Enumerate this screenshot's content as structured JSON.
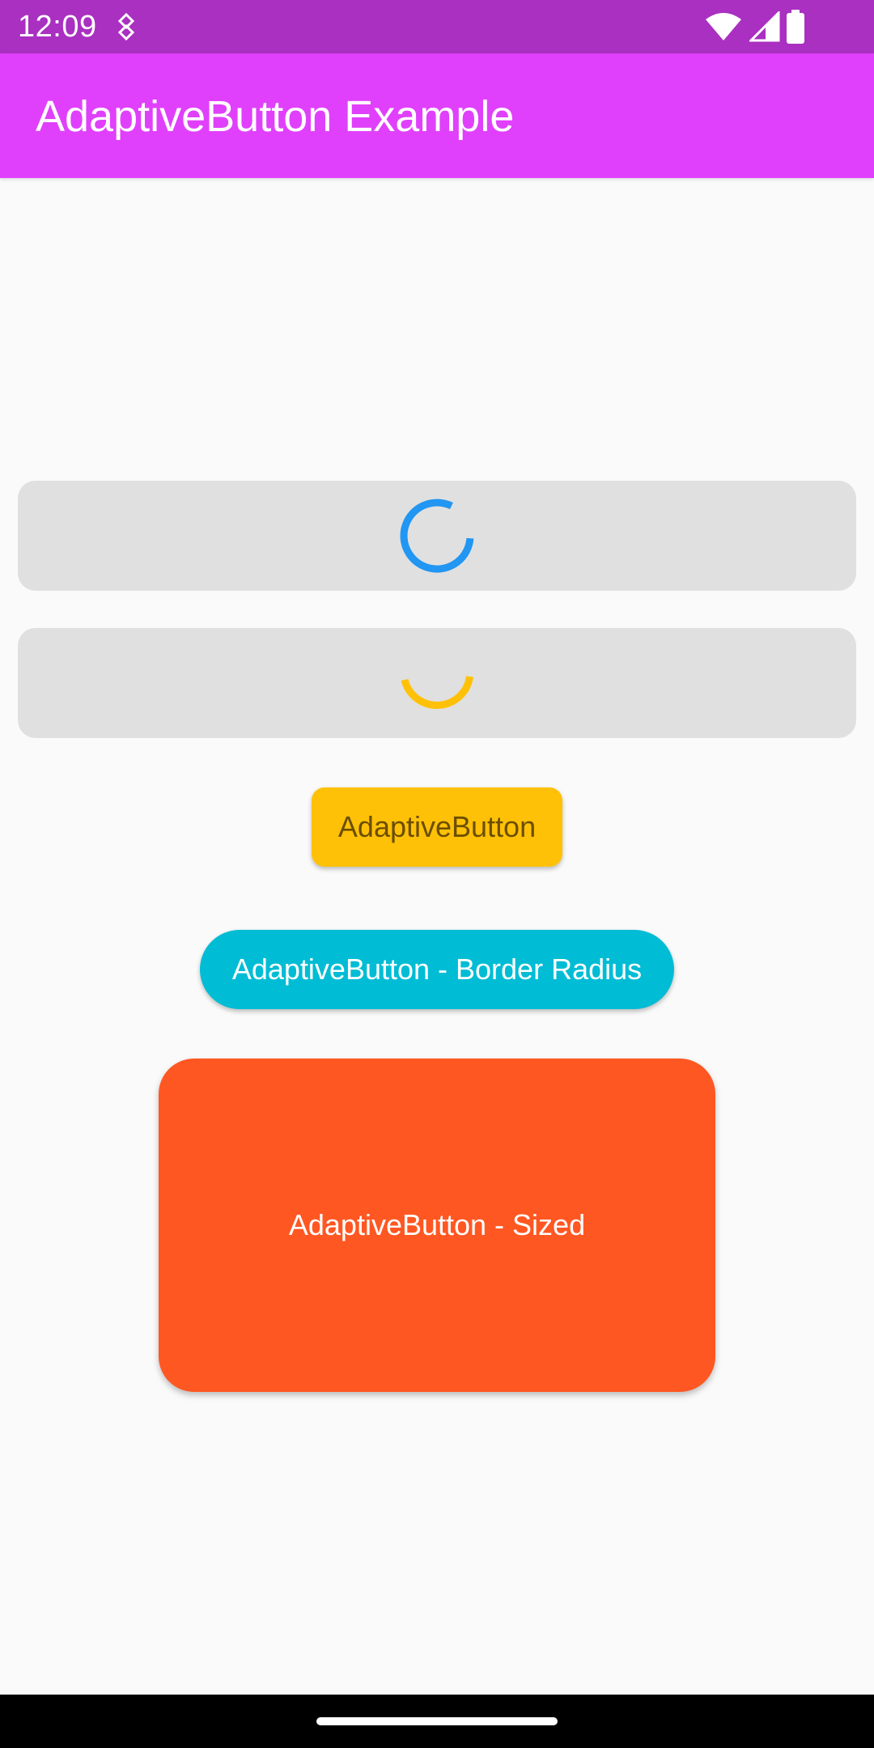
{
  "status_bar": {
    "time": "12:09",
    "notification_icon": "android-notification-icon",
    "wifi_icon": "wifi-icon",
    "signal_icon": "cell-signal-icon",
    "battery_icon": "battery-icon"
  },
  "app_bar": {
    "title": "AdaptiveButton Example",
    "color": "#e040fb"
  },
  "buttons": {
    "loading_1": {
      "state": "loading",
      "spinner_color": "#2196f3",
      "background": "#e0e0e0"
    },
    "loading_2": {
      "state": "loading",
      "spinner_color": "#ffc107",
      "background": "#e0e0e0"
    },
    "basic": {
      "label": "AdaptiveButton",
      "color": "#ffc107"
    },
    "border_radius": {
      "label": "AdaptiveButton - Border Radius",
      "color": "#00bcd4"
    },
    "sized": {
      "label": "AdaptiveButton - Sized",
      "color": "#ff5722"
    }
  },
  "nav_bar": {
    "handle_icon": "home-gesture-handle"
  }
}
